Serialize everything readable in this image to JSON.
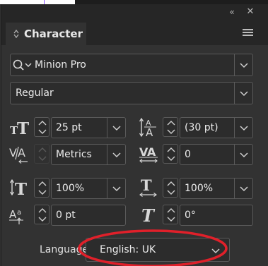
{
  "panel": {
    "title": "Character",
    "collapse_glyph": "«",
    "close_glyph": "✕",
    "tab_arrows_glyph": "◇"
  },
  "font_family": {
    "value": "Minion Pro",
    "icon": "search-icon"
  },
  "font_style": {
    "value": "Regular"
  },
  "font_size": {
    "value": "25 pt",
    "icon": "font-size-icon"
  },
  "leading": {
    "value": "(30 pt)",
    "icon": "leading-icon"
  },
  "kerning": {
    "value": "Metrics",
    "icon": "kerning-icon"
  },
  "tracking": {
    "value": "0",
    "icon": "tracking-icon"
  },
  "vertical_scale": {
    "value": "100%",
    "icon": "vertical-scale-icon"
  },
  "horizontal_scale": {
    "value": "100%",
    "icon": "horizontal-scale-icon"
  },
  "baseline_shift": {
    "value": "0 pt",
    "icon": "baseline-shift-icon"
  },
  "skew": {
    "value": "0°",
    "icon": "skew-icon"
  },
  "language": {
    "label": "Language:",
    "value": "English: UK"
  },
  "colors": {
    "panel_bg": "#323232",
    "header_bg": "#262626",
    "field_bg": "#2c2c2c",
    "field_border": "#5a5a5a",
    "text": "#e0e0e0",
    "highlight": "#e0202a"
  }
}
